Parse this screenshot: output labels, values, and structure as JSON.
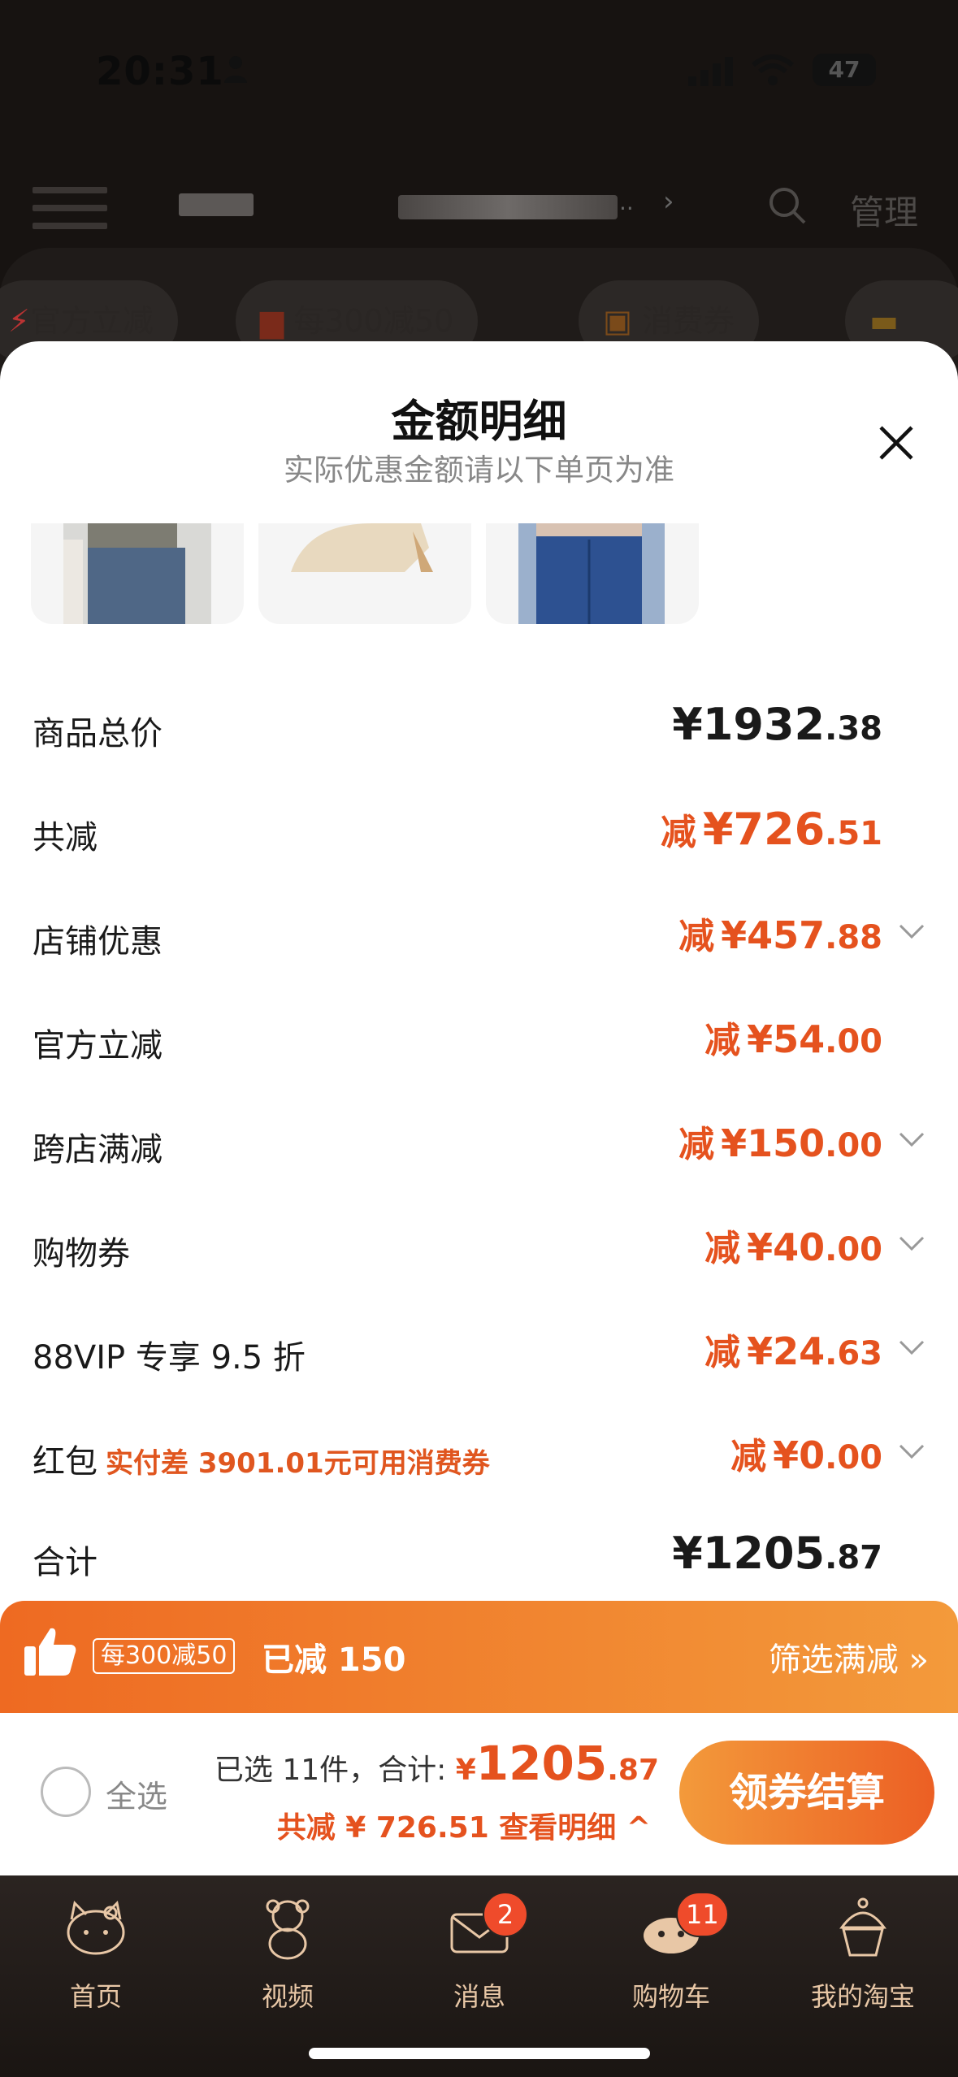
{
  "status_bar": {
    "time": "20:31",
    "battery": "47"
  },
  "nav": {
    "ellipsis": "..",
    "manage_label": "管理"
  },
  "coupon_chips": [
    {
      "label": "官方立减"
    },
    {
      "label": "每300减50"
    },
    {
      "label": "消费券"
    }
  ],
  "sheet": {
    "title": "金额明细",
    "subtitle": "实际优惠金额请以下单页为准"
  },
  "breakdown": [
    {
      "label": "商品总价",
      "prefix": "",
      "int": "¥1932",
      "dec": ".38"
    },
    {
      "label": "共减",
      "prefix": "减",
      "int": "¥726",
      "dec": ".51"
    },
    {
      "label": "店铺优惠",
      "prefix": "减",
      "int": "¥457",
      "dec": ".88"
    },
    {
      "label": "官方立减",
      "prefix": "减",
      "int": "¥54",
      "dec": ".00"
    },
    {
      "label": "跨店满减",
      "prefix": "减",
      "int": "¥150",
      "dec": ".00"
    },
    {
      "label": "购物券",
      "prefix": "减",
      "int": "¥40",
      "dec": ".00"
    },
    {
      "label": "88VIP 专享 9.5 折",
      "prefix": "减",
      "int": "¥24",
      "dec": ".63"
    },
    {
      "label": "红包",
      "note": "实付差 3901.01元可用消费券",
      "prefix": "减",
      "int": "¥0",
      "dec": ".00"
    },
    {
      "label": "合计",
      "prefix": "",
      "int": "¥1205",
      "dec": ".87"
    }
  ],
  "banner": {
    "tag": "每300减50",
    "applied": "已减 150",
    "filter": "筛选满减 »"
  },
  "checkout": {
    "select_all": "全选",
    "selected_prefix": "已选 11件，合计:",
    "yen": "¥",
    "total_int": "1205",
    "total_dec": ".87",
    "discount_line": "共减 ¥ 726.51  查看明细 ^",
    "button": "领券结算"
  },
  "tabs": [
    {
      "label": "首页",
      "badge": ""
    },
    {
      "label": "视频",
      "badge": ""
    },
    {
      "label": "消息",
      "badge": "2"
    },
    {
      "label": "购物车",
      "badge": "11"
    },
    {
      "label": "我的淘宝",
      "badge": ""
    }
  ],
  "colors": {
    "accent": "#e5521e",
    "banner": "#ee6a22",
    "tab_text": "#e8c7a6"
  }
}
